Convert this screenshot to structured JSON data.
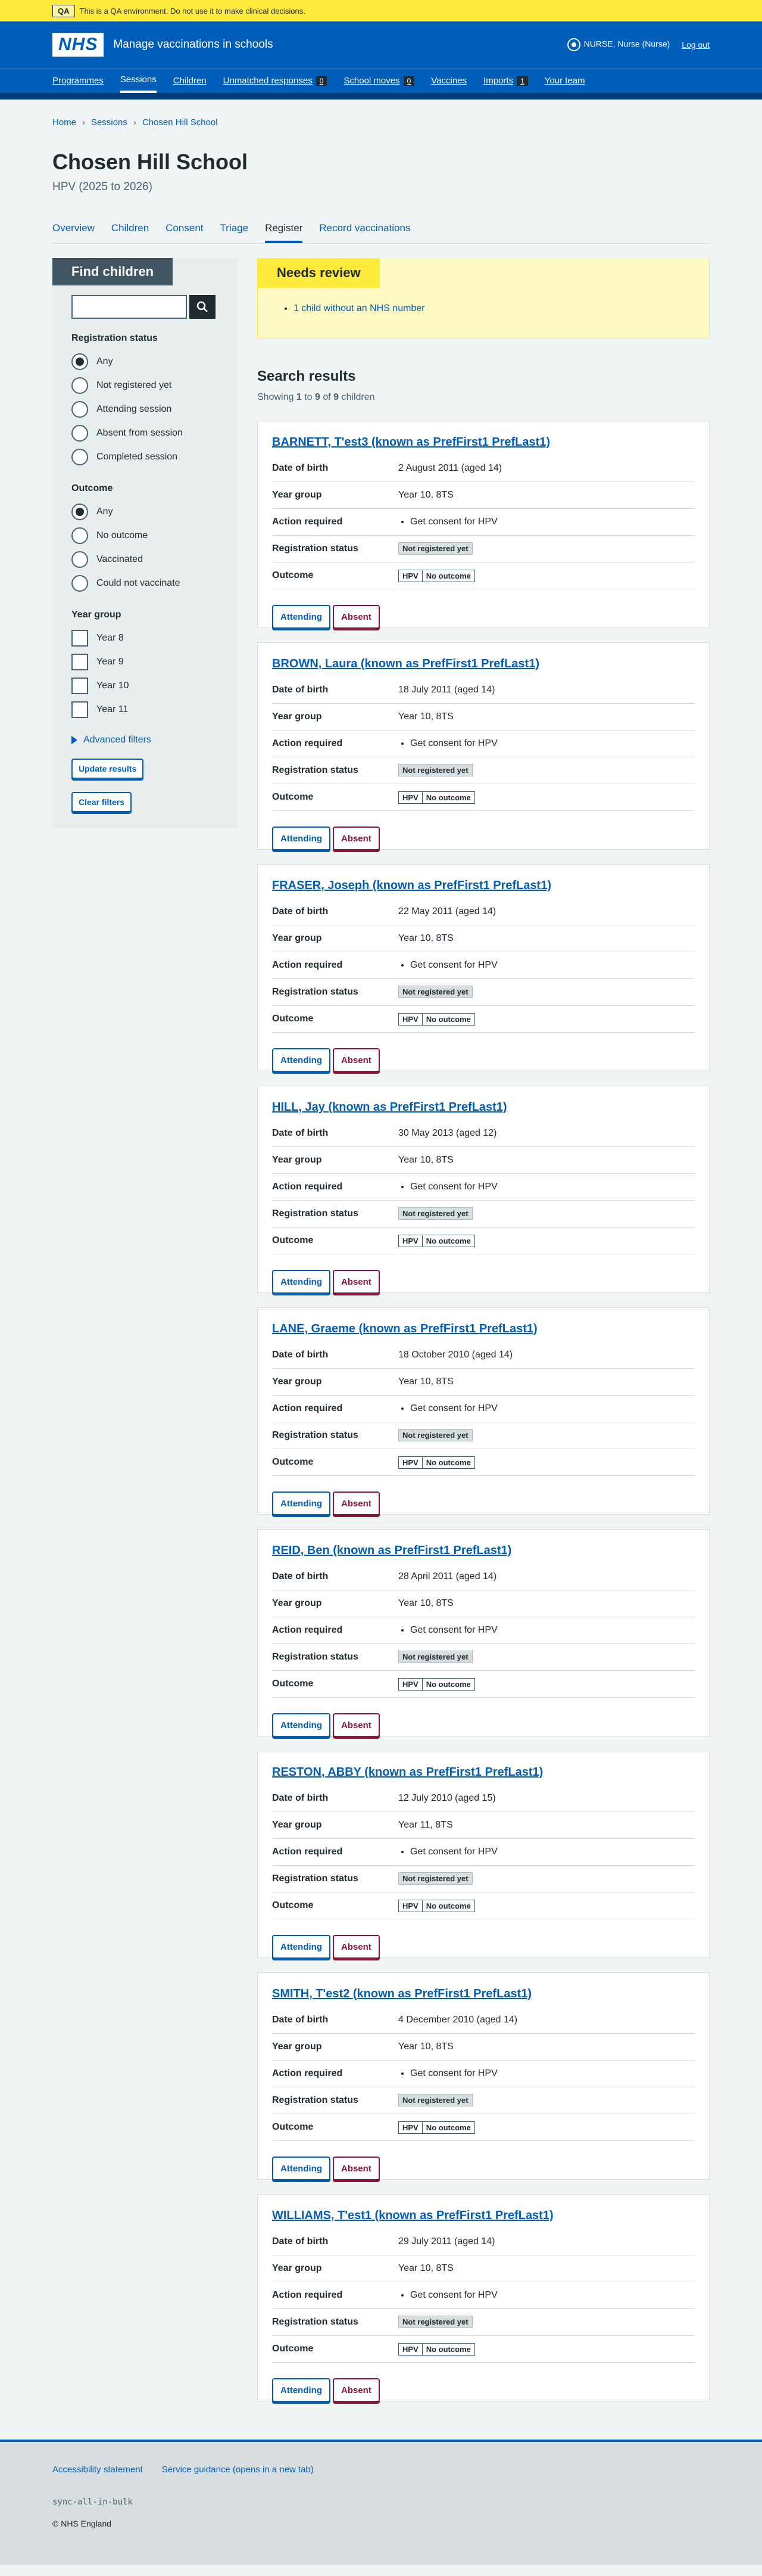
{
  "qa": {
    "tag": "QA",
    "message": "This is a QA environment. Do not use it to make clinical decisions."
  },
  "header": {
    "logo": "NHS",
    "service_name": "Manage vaccinations in schools",
    "user": "NURSE, Nurse (Nurse)",
    "logout": "Log out"
  },
  "nav": [
    {
      "label": "Programmes",
      "count": null,
      "active": false
    },
    {
      "label": "Sessions",
      "count": null,
      "active": true
    },
    {
      "label": "Children",
      "count": null,
      "active": false
    },
    {
      "label": "Unmatched responses",
      "count": "0",
      "active": false
    },
    {
      "label": "School moves",
      "count": "0",
      "active": false
    },
    {
      "label": "Vaccines",
      "count": null,
      "active": false
    },
    {
      "label": "Imports",
      "count": "1",
      "active": false
    },
    {
      "label": "Your team",
      "count": null,
      "active": false
    }
  ],
  "breadcrumb": [
    "Home",
    "Sessions",
    "Chosen Hill School"
  ],
  "page": {
    "title": "Chosen Hill School",
    "subtitle": "HPV (2025 to 2026)"
  },
  "sub_nav": [
    {
      "label": "Overview",
      "active": false
    },
    {
      "label": "Children",
      "active": false
    },
    {
      "label": "Consent",
      "active": false
    },
    {
      "label": "Triage",
      "active": false
    },
    {
      "label": "Register",
      "active": true
    },
    {
      "label": "Record vaccinations",
      "active": false
    }
  ],
  "filters": {
    "heading": "Find children",
    "search_value": "",
    "registration_legend": "Registration status",
    "registration_options": [
      "Any",
      "Not registered yet",
      "Attending session",
      "Absent from session",
      "Completed session"
    ],
    "registration_selected": 0,
    "outcome_legend": "Outcome",
    "outcome_options": [
      "Any",
      "No outcome",
      "Vaccinated",
      "Could not vaccinate"
    ],
    "outcome_selected": 0,
    "year_legend": "Year group",
    "year_options": [
      "Year 8",
      "Year 9",
      "Year 10",
      "Year 11"
    ],
    "advanced": "Advanced filters",
    "update_button": "Update results",
    "clear_button": "Clear filters"
  },
  "review": {
    "heading": "Needs review",
    "item": "1 child without an NHS number"
  },
  "results": {
    "heading": "Search results",
    "count_prefix": "Showing ",
    "from": "1",
    "to_word": " to ",
    "to": "9",
    "of_word": " of ",
    "total": "9",
    "count_suffix": " children"
  },
  "labels": {
    "dob": "Date of birth",
    "year_group": "Year group",
    "action": "Action required",
    "registration": "Registration status",
    "outcome": "Outcome",
    "attending": "Attending",
    "absent": "Absent"
  },
  "children": [
    {
      "name": "BARNETT, T'est3 (known as PrefFirst1 PrefLast1)",
      "dob": "2 August 2011 (aged 14)",
      "year_group": "Year 10, 8TS",
      "action": "Get consent for HPV",
      "registration": "Not registered yet",
      "programme": "HPV",
      "outcome": "No outcome"
    },
    {
      "name": "BROWN, Laura (known as PrefFirst1 PrefLast1)",
      "dob": "18 July 2011 (aged 14)",
      "year_group": "Year 10, 8TS",
      "action": "Get consent for HPV",
      "registration": "Not registered yet",
      "programme": "HPV",
      "outcome": "No outcome"
    },
    {
      "name": "FRASER, Joseph (known as PrefFirst1 PrefLast1)",
      "dob": "22 May 2011 (aged 14)",
      "year_group": "Year 10, 8TS",
      "action": "Get consent for HPV",
      "registration": "Not registered yet",
      "programme": "HPV",
      "outcome": "No outcome"
    },
    {
      "name": "HILL, Jay (known as PrefFirst1 PrefLast1)",
      "dob": "30 May 2013 (aged 12)",
      "year_group": "Year 10, 8TS",
      "action": "Get consent for HPV",
      "registration": "Not registered yet",
      "programme": "HPV",
      "outcome": "No outcome"
    },
    {
      "name": "LANE, Graeme (known as PrefFirst1 PrefLast1)",
      "dob": "18 October 2010 (aged 14)",
      "year_group": "Year 10, 8TS",
      "action": "Get consent for HPV",
      "registration": "Not registered yet",
      "programme": "HPV",
      "outcome": "No outcome"
    },
    {
      "name": "REID, Ben (known as PrefFirst1 PrefLast1)",
      "dob": "28 April 2011 (aged 14)",
      "year_group": "Year 10, 8TS",
      "action": "Get consent for HPV",
      "registration": "Not registered yet",
      "programme": "HPV",
      "outcome": "No outcome"
    },
    {
      "name": "RESTON, ABBY (known as PrefFirst1 PrefLast1)",
      "dob": "12 July 2010 (aged 15)",
      "year_group": "Year 11, 8TS",
      "action": "Get consent for HPV",
      "registration": "Not registered yet",
      "programme": "HPV",
      "outcome": "No outcome"
    },
    {
      "name": "SMITH, T'est2 (known as PrefFirst1 PrefLast1)",
      "dob": "4 December 2010 (aged 14)",
      "year_group": "Year 10, 8TS",
      "action": "Get consent for HPV",
      "registration": "Not registered yet",
      "programme": "HPV",
      "outcome": "No outcome"
    },
    {
      "name": "WILLIAMS, T'est1 (known as PrefFirst1 PrefLast1)",
      "dob": "29 July 2011 (aged 14)",
      "year_group": "Year 10, 8TS",
      "action": "Get consent for HPV",
      "registration": "Not registered yet",
      "programme": "HPV",
      "outcome": "No outcome"
    }
  ],
  "footer": {
    "links": [
      "Accessibility statement",
      "Service guidance (opens in a new tab)"
    ],
    "code": "sync-all-in-bulk",
    "copyright": "© NHS England"
  },
  "colors": {
    "brand_blue": "#005eb8",
    "qa_yellow": "#ffeb3b",
    "absent_red": "#8a1538"
  },
  "icons": {
    "search": "search-icon",
    "user": "user-icon",
    "advanced": "triangle-right-icon"
  }
}
